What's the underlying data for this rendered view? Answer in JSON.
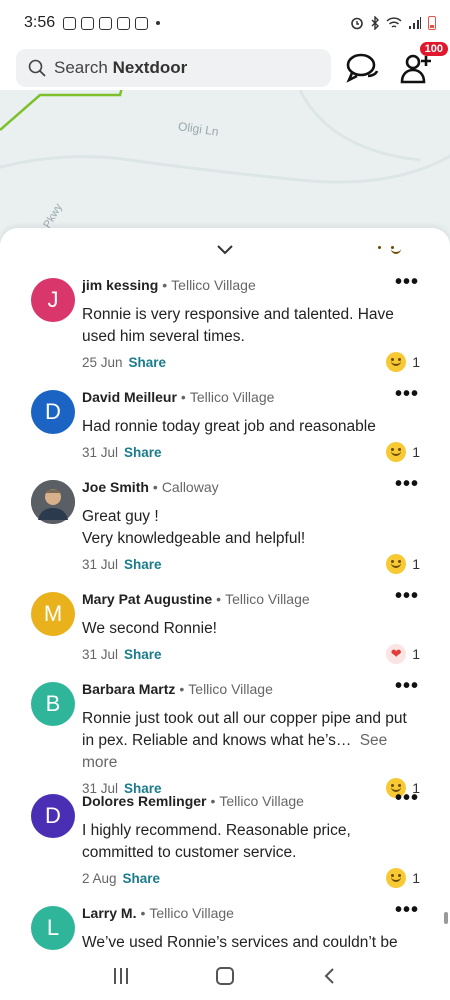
{
  "status_bar": {
    "time": "3:56"
  },
  "header": {
    "search_prefix": "Search",
    "search_brand": "Nextdoor",
    "invite_badge": "100"
  },
  "map": {
    "road_label": "Oligi Ln",
    "road_label2": "Pkwy"
  },
  "comments": [
    {
      "initial": "J",
      "avatar_color": "#d9366b",
      "name": "jim kessing",
      "location": "Tellico Village",
      "text": "Ronnie is very responsive and talented.  Have used him several times.",
      "date": "25 Jun",
      "share": "Share",
      "reaction_count": "1",
      "reaction": "smile"
    },
    {
      "initial": "D",
      "avatar_color": "#1b64c4",
      "name": "David Meilleur",
      "location": "Tellico Village",
      "text": "Had ronnie today great job and reasonable",
      "date": "31 Jul",
      "share": "Share",
      "reaction_count": "1",
      "reaction": "smile"
    },
    {
      "initial": "",
      "avatar_color": "#6b6b6b",
      "name": "Joe Smith",
      "location": "Calloway",
      "text": "Great guy !\nVery knowledgeable and helpful!",
      "date": "31 Jul",
      "share": "Share",
      "reaction_count": "1",
      "reaction": "smile"
    },
    {
      "initial": "M",
      "avatar_color": "#e9b21d",
      "name": "Mary Pat Augustine",
      "location": "Tellico Village",
      "text": "We second Ronnie!",
      "date": "31 Jul",
      "share": "Share",
      "reaction_count": "1",
      "reaction": "heart"
    },
    {
      "initial": "B",
      "avatar_color": "#2fb59a",
      "name": "Barbara Martz",
      "location": "Tellico Village",
      "text": "Ronnie just took out all our copper pipe and put in pex. Reliable and knows what he’s…",
      "see_more": "See more",
      "date": "31 Jul",
      "share": "Share",
      "reaction_count": "1",
      "reaction": "smile"
    },
    {
      "initial": "D",
      "avatar_color": "#4a2fb5",
      "name": "Dolores Remlinger",
      "location": "Tellico Village",
      "text": "I highly recommend.  Reasonable price, committed to customer service.",
      "date": "2 Aug",
      "share": "Share",
      "reaction_count": "1",
      "reaction": "smile"
    },
    {
      "initial": "L",
      "avatar_color": "#2fb59a",
      "name": "Larry M.",
      "location": "Tellico Village",
      "text": "We’ve used Ronnie’s services and couldn’t be",
      "date": "",
      "share": "",
      "reaction_count": "",
      "reaction": ""
    }
  ]
}
